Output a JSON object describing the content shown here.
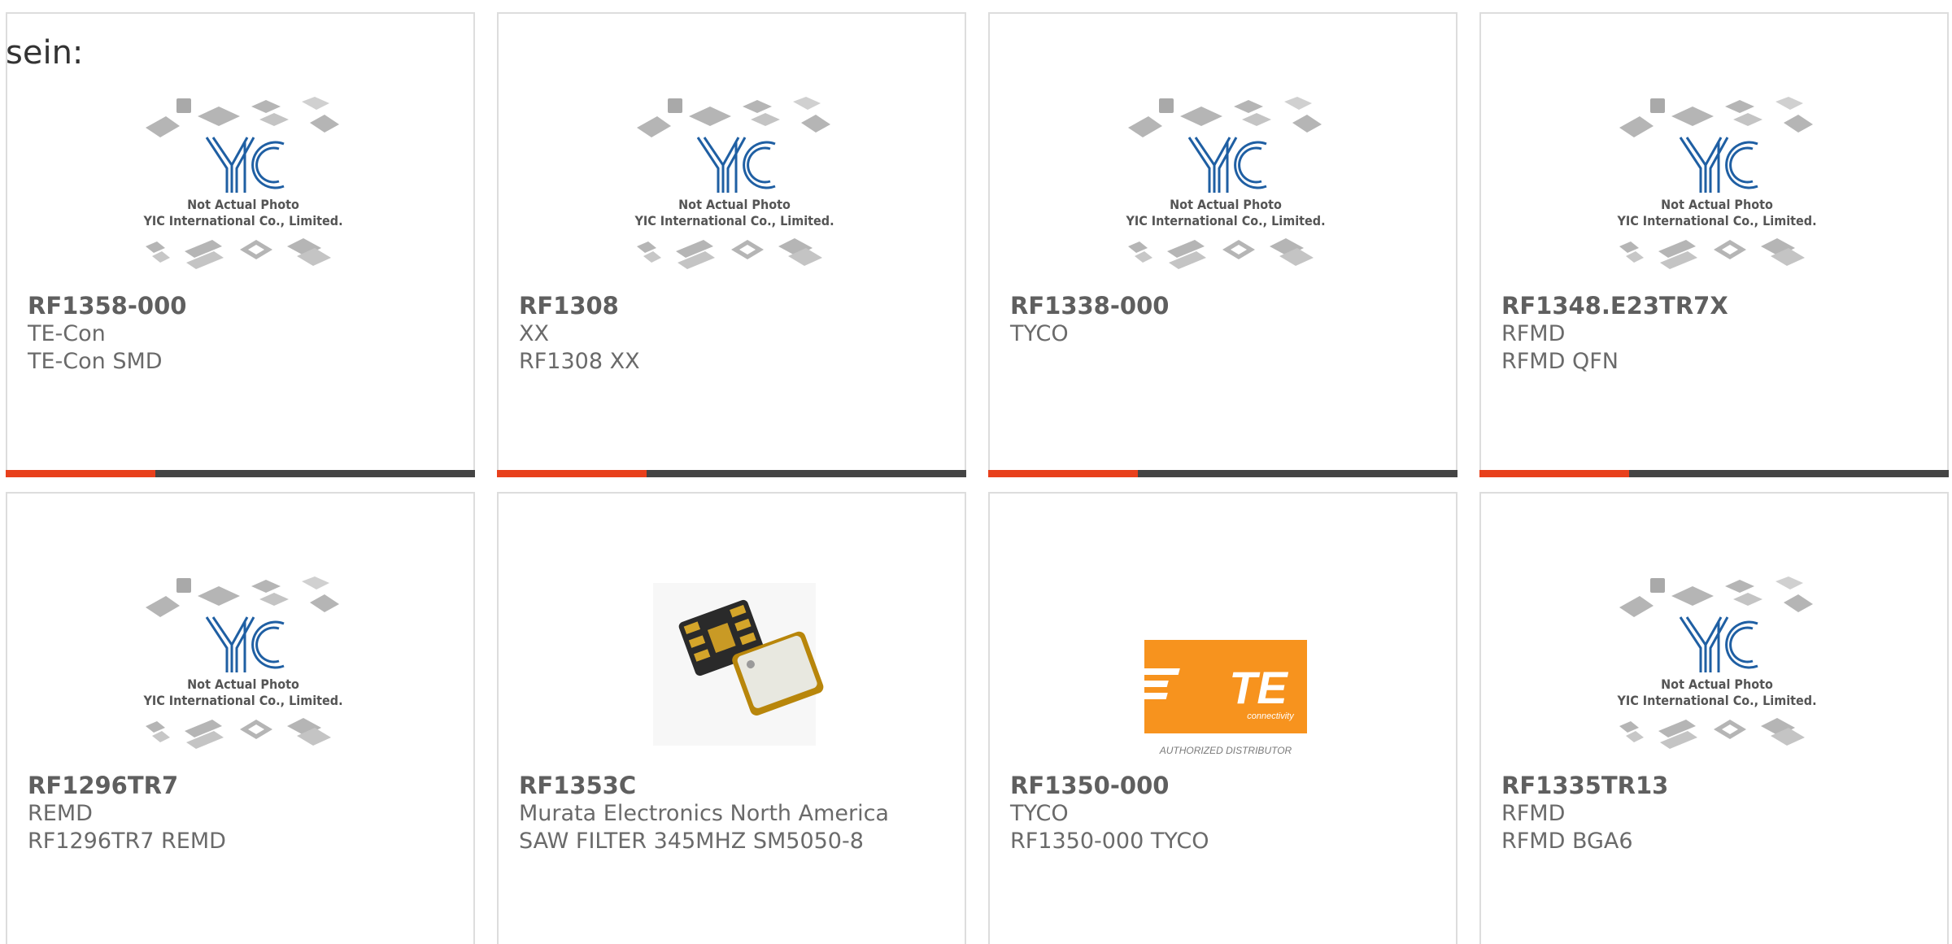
{
  "lead_text": "sein:",
  "placeholder": {
    "logo_text": "YIC",
    "line1": "Not Actual Photo",
    "line2": "YIC International Co., Limited."
  },
  "te_logo": {
    "text": "TE",
    "sub": "connectivity",
    "caption": "AUTHORIZED DISTRIBUTOR",
    "color": "#f7931e"
  },
  "colors": {
    "accent": "#e8401c",
    "bar": "#444444"
  },
  "products": [
    {
      "part": "RF1358-000",
      "manufacturer": "TE-Con",
      "description": "TE-Con SMD",
      "image": "placeholder"
    },
    {
      "part": "RF1308",
      "manufacturer": "XX",
      "description": "RF1308 XX",
      "image": "placeholder"
    },
    {
      "part": "RF1338-000",
      "manufacturer": "TYCO",
      "description": "",
      "image": "placeholder"
    },
    {
      "part": "RF1348.E23TR7X",
      "manufacturer": "RFMD",
      "description": "RFMD QFN",
      "image": "placeholder"
    },
    {
      "part": "RF1296TR7",
      "manufacturer": "REMD",
      "description": "RF1296TR7 REMD",
      "image": "placeholder"
    },
    {
      "part": "RF1353C",
      "manufacturer": "Murata Electronics North America",
      "description": "SAW FILTER 345MHZ SM5050-8",
      "image": "saw-filter"
    },
    {
      "part": "RF1350-000",
      "manufacturer": "TYCO",
      "description": "RF1350-000 TYCO",
      "image": "te-logo"
    },
    {
      "part": "RF1335TR13",
      "manufacturer": "RFMD",
      "description": "RFMD BGA6",
      "image": "placeholder"
    }
  ]
}
